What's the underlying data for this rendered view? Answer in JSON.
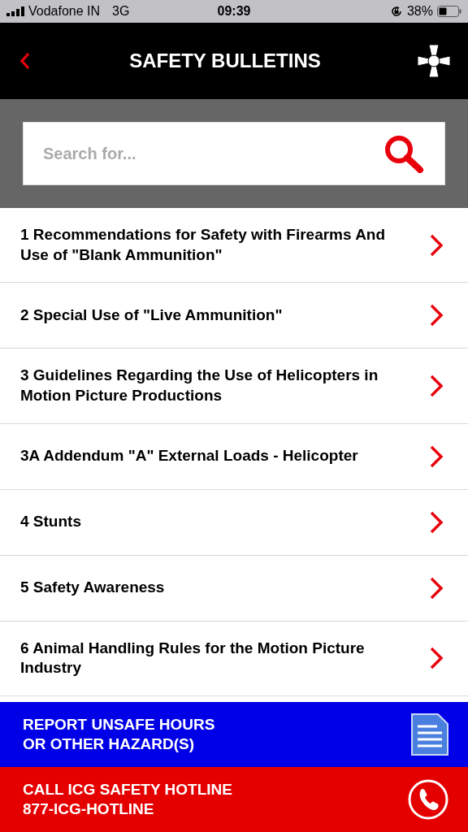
{
  "status_bar": {
    "carrier": "Vodafone IN",
    "network": "3G",
    "time": "09:39",
    "battery": "38%"
  },
  "header": {
    "title": "SAFETY BULLETINS"
  },
  "search": {
    "placeholder": "Search for..."
  },
  "bulletins": [
    {
      "title": "1 Recommendations for Safety with Firearms And Use of \"Blank Ammunition\""
    },
    {
      "title": "2 Special Use of \"Live Ammunition\""
    },
    {
      "title": "3 Guidelines Regarding the Use of Helicopters in Motion Picture Productions"
    },
    {
      "title": "3A Addendum \"A\" External Loads - Helicopter"
    },
    {
      "title": "4 Stunts"
    },
    {
      "title": "5 Safety Awareness"
    },
    {
      "title": "6 Animal Handling Rules for the Motion Picture Industry"
    }
  ],
  "actions": [
    {
      "kind": "report",
      "lines": [
        "REPORT UNSAFE HOURS",
        "OR OTHER HAZARD(S)"
      ]
    },
    {
      "kind": "call",
      "lines": [
        "CALL ICG SAFETY HOTLINE",
        "877-ICG-HOTLINE"
      ]
    }
  ]
}
